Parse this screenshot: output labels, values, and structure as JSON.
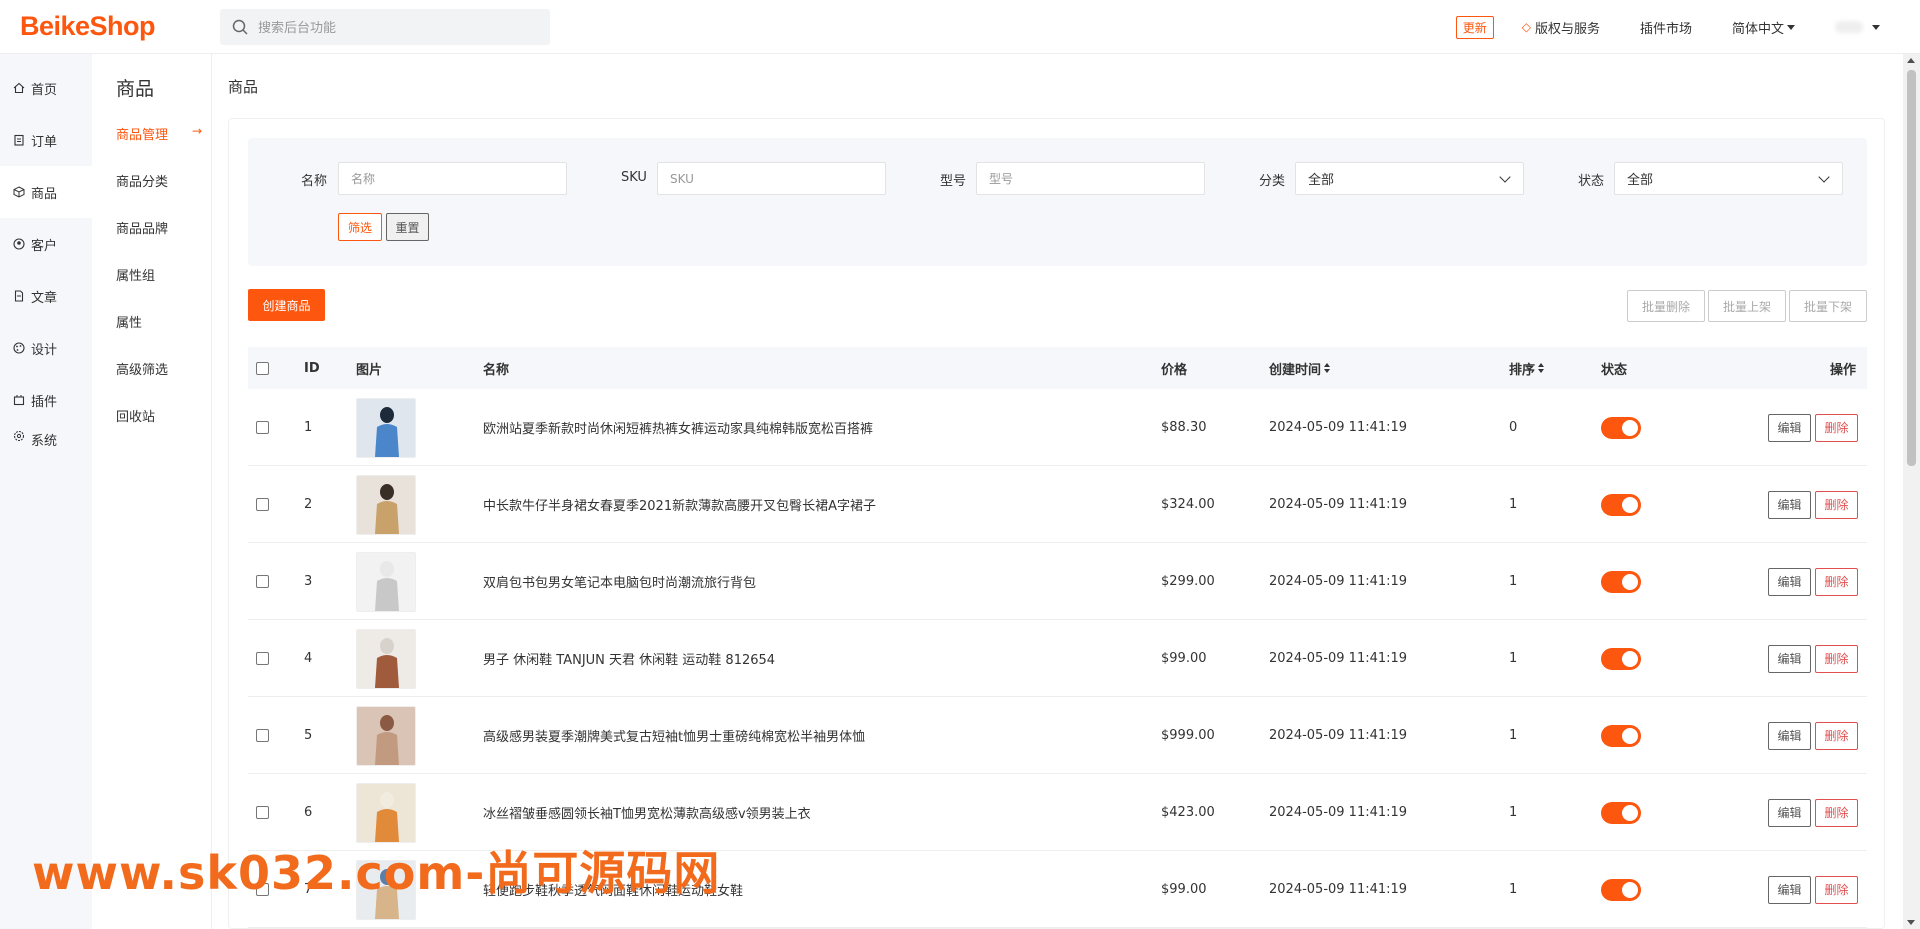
{
  "header": {
    "logo": "BeikeShop",
    "search_placeholder": "搜索后台功能",
    "update_label": "更新",
    "license_label": "版权与服务",
    "plugin_market_label": "插件市场",
    "language_label": "简体中文"
  },
  "rail": {
    "items": [
      {
        "label": "首页",
        "icon": "home-icon"
      },
      {
        "label": "订单",
        "icon": "clipboard-icon"
      },
      {
        "label": "商品",
        "icon": "box-icon"
      },
      {
        "label": "客户",
        "icon": "user-icon"
      },
      {
        "label": "文章",
        "icon": "document-icon"
      },
      {
        "label": "设计",
        "icon": "palette-icon"
      },
      {
        "label": "插件",
        "icon": "plugin-icon"
      },
      {
        "label": "系统",
        "icon": "gear-icon"
      }
    ]
  },
  "subnav": {
    "title": "商品",
    "items": [
      "商品管理",
      "商品分类",
      "商品品牌",
      "属性组",
      "属性",
      "高级筛选",
      "回收站"
    ],
    "active_arrow": "→"
  },
  "page_title": "商品",
  "filter": {
    "name_label": "名称",
    "name_placeholder": "名称",
    "sku_label": "SKU",
    "sku_placeholder": "SKU",
    "model_label": "型号",
    "model_placeholder": "型号",
    "category_label": "分类",
    "category_value": "全部",
    "status_label": "状态",
    "status_value": "全部",
    "filter_button": "筛选",
    "reset_button": "重置"
  },
  "actions": {
    "create": "创建商品",
    "batch_delete": "批量删除",
    "batch_on": "批量上架",
    "batch_off": "批量下架"
  },
  "table": {
    "headers": {
      "id": "ID",
      "image": "图片",
      "name": "名称",
      "price": "价格",
      "created": "创建时间",
      "sort": "排序",
      "status": "状态",
      "ops": "操作"
    },
    "edit_label": "编辑",
    "delete_label": "删除",
    "rows": [
      {
        "id": "1",
        "name": "欧洲站夏季新款时尚休闲短裤热裤女裤运动家具纯棉韩版宽松百搭裤",
        "price": "$88.30",
        "created": "2024-05-09 11:41:19",
        "sort": "0",
        "enabled": true
      },
      {
        "id": "2",
        "name": "中长款牛仔半身裙女春夏季2021新款薄款高腰开叉包臀长裙A字裙子",
        "price": "$324.00",
        "created": "2024-05-09 11:41:19",
        "sort": "1",
        "enabled": true
      },
      {
        "id": "3",
        "name": "双肩包书包男女笔记本电脑包时尚潮流旅行背包",
        "price": "$299.00",
        "created": "2024-05-09 11:41:19",
        "sort": "1",
        "enabled": true
      },
      {
        "id": "4",
        "name": "男子 休闲鞋 TANJUN 天君 休闲鞋 运动鞋 812654",
        "price": "$99.00",
        "created": "2024-05-09 11:41:19",
        "sort": "1",
        "enabled": true
      },
      {
        "id": "5",
        "name": "高级感男装夏季潮牌美式复古短袖t恤男士重磅纯棉宽松半袖男体恤",
        "price": "$999.00",
        "created": "2024-05-09 11:41:19",
        "sort": "1",
        "enabled": true
      },
      {
        "id": "6",
        "name": "冰丝褶皱垂感圆领长袖T恤男宽松薄款高级感v领男装上衣",
        "price": "$423.00",
        "created": "2024-05-09 11:41:19",
        "sort": "1",
        "enabled": true
      },
      {
        "id": "7",
        "name": "轻便跑步鞋秋季透气网面鞋休闲鞋运动鞋女鞋",
        "price": "$99.00",
        "created": "2024-05-09 11:41:19",
        "sort": "1",
        "enabled": true
      }
    ]
  },
  "watermark": "www.sk032.com-尚可源码网",
  "colors": {
    "accent": "#fd560f",
    "rail_bg": "#f6f7fb"
  }
}
